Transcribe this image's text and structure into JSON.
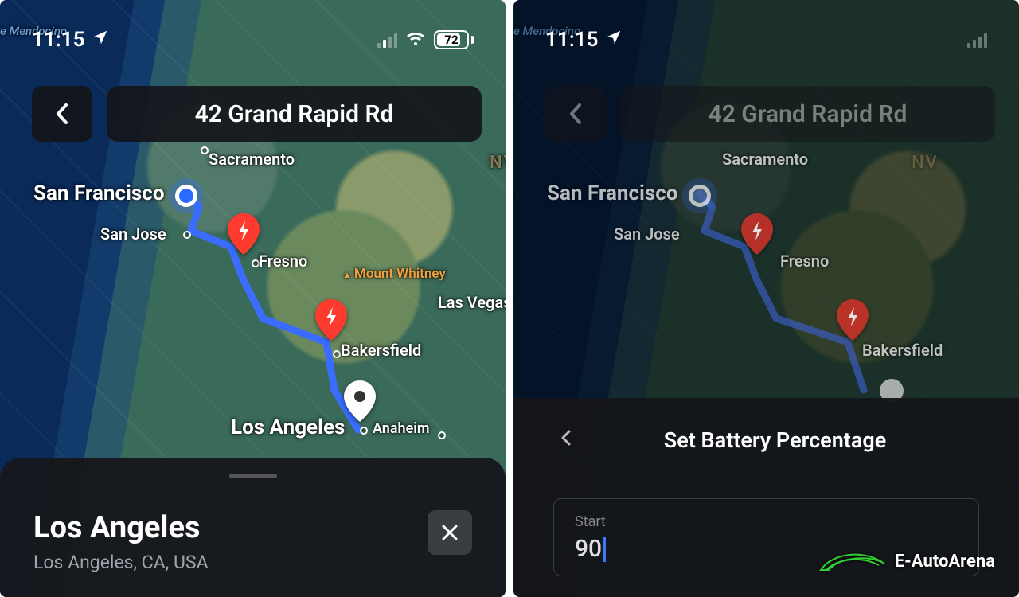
{
  "status": {
    "time": "11:15",
    "battery": "72"
  },
  "header": {
    "address": "42 Grand Rapid Rd"
  },
  "map": {
    "cape_mendocino": "e Mendocino",
    "sf": "San Francisco",
    "sj": "San Jose",
    "sac": "Sacramento",
    "fresno": "Fresno",
    "bakers": "Bakersfield",
    "la": "Los Angeles",
    "anaheim": "Anaheim",
    "lv": "Las Vegas",
    "whitney": "Mount Whitney",
    "nv": "NV"
  },
  "sheet": {
    "title": "Los Angeles",
    "subtitle": "Los Angeles, CA, USA"
  },
  "panel": {
    "title": "Set Battery Percentage",
    "start_label": "Start",
    "start_value": "90"
  },
  "watermark": "E-AutoArena"
}
